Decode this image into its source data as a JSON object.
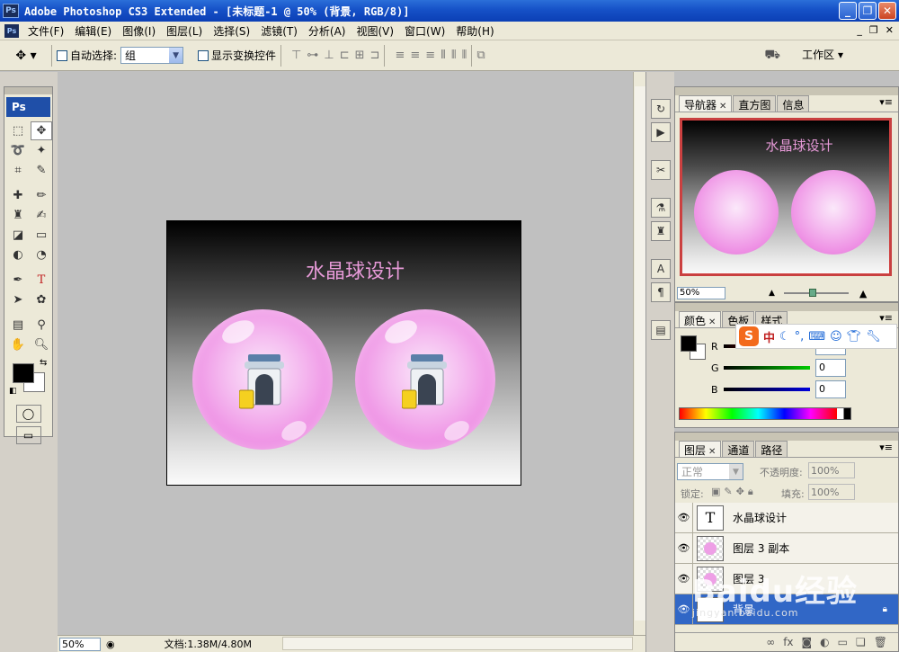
{
  "window": {
    "title": "Adobe Photoshop CS3 Extended - [未标题-1 @ 50% (背景, RGB/8)]",
    "app_icon": "Ps",
    "buttons": [
      "_",
      "❐",
      "✕"
    ]
  },
  "menu": {
    "items": [
      "文件(F)",
      "编辑(E)",
      "图像(I)",
      "图层(L)",
      "选择(S)",
      "滤镜(T)",
      "分析(A)",
      "视图(V)",
      "窗口(W)",
      "帮助(H)"
    ],
    "doc_controls": [
      "_",
      "❐",
      "✕"
    ]
  },
  "options": {
    "auto_select_label": "自动选择:",
    "auto_select_value": "组",
    "show_transform_label": "显示变换控件",
    "workspace_label": "工作区 ▾"
  },
  "toolbox": {
    "badge": "Ps"
  },
  "canvas": {
    "title_text": "水晶球设计",
    "background_gradient": [
      "#000000",
      "#ffffff"
    ],
    "ball_color": "#ee8fe4",
    "title_color": "#e79ad8"
  },
  "status": {
    "zoom": "50%",
    "doc_info": "文档:1.38M/4.80M"
  },
  "navigator": {
    "tabs": [
      "导航器",
      "直方图",
      "信息"
    ],
    "zoom": "50%"
  },
  "color_panel": {
    "tabs": [
      "颜色",
      "色板",
      "样式"
    ],
    "channels": [
      {
        "label": "R",
        "value": "0",
        "color": "#d02020"
      },
      {
        "label": "G",
        "value": "0",
        "color": "#20a020"
      },
      {
        "label": "B",
        "value": "0",
        "color": "#2020c0"
      }
    ]
  },
  "ime_bar": {
    "logo": "S",
    "mode": "中"
  },
  "layers_panel": {
    "tabs": [
      "图层",
      "通道",
      "路径"
    ],
    "blend_mode": "正常",
    "opacity_label": "不透明度:",
    "opacity_value": "100%",
    "lock_label": "锁定:",
    "fill_label": "填充:",
    "fill_value": "100%",
    "layers": [
      {
        "name": "水晶球设计",
        "thumb": "T",
        "selected": false
      },
      {
        "name": "图层 3 副本",
        "thumb": "checker",
        "selected": false
      },
      {
        "name": "图层 3",
        "thumb": "checker",
        "selected": false
      },
      {
        "name": "背景",
        "thumb": "white",
        "selected": true
      }
    ]
  },
  "watermark": {
    "brand": "Baidu经验",
    "url": "jingyan.baidu.com"
  }
}
